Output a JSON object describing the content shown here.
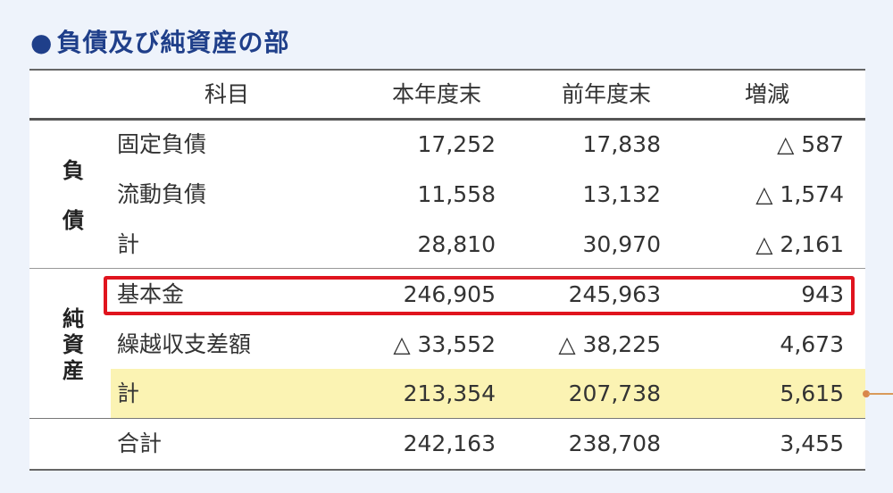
{
  "title": "負債及び純資産の部",
  "title_bullet": "●",
  "headers": {
    "item": "科目",
    "current": "本年度末",
    "previous": "前年度末",
    "change": "増減"
  },
  "groups": {
    "liabilities": [
      "負",
      "債"
    ],
    "net_assets": [
      "純",
      "資",
      "産"
    ]
  },
  "rows": [
    {
      "label": "固定負債",
      "current": "17,252",
      "previous": "17,838",
      "change": "△ 587"
    },
    {
      "label": "流動負債",
      "current": "11,558",
      "previous": "13,132",
      "change": "△ 1,574"
    },
    {
      "label": "計",
      "current": "28,810",
      "previous": "30,970",
      "change": "△ 2,161"
    },
    {
      "label": "基本金",
      "current": "246,905",
      "previous": "245,963",
      "change": "943"
    },
    {
      "label": "繰越収支差額",
      "current": "△ 33,552",
      "previous": "△ 38,225",
      "change": "4,673"
    },
    {
      "label": "計",
      "current": "213,354",
      "previous": "207,738",
      "change": "5,615"
    },
    {
      "label": "合計",
      "current": "242,163",
      "previous": "238,708",
      "change": "3,455"
    }
  ],
  "colors": {
    "title": "#1f3f8a",
    "highlight_fill": "#fbf3b3",
    "highlight_border": "#e0141e",
    "connector": "#d99a5a"
  }
}
